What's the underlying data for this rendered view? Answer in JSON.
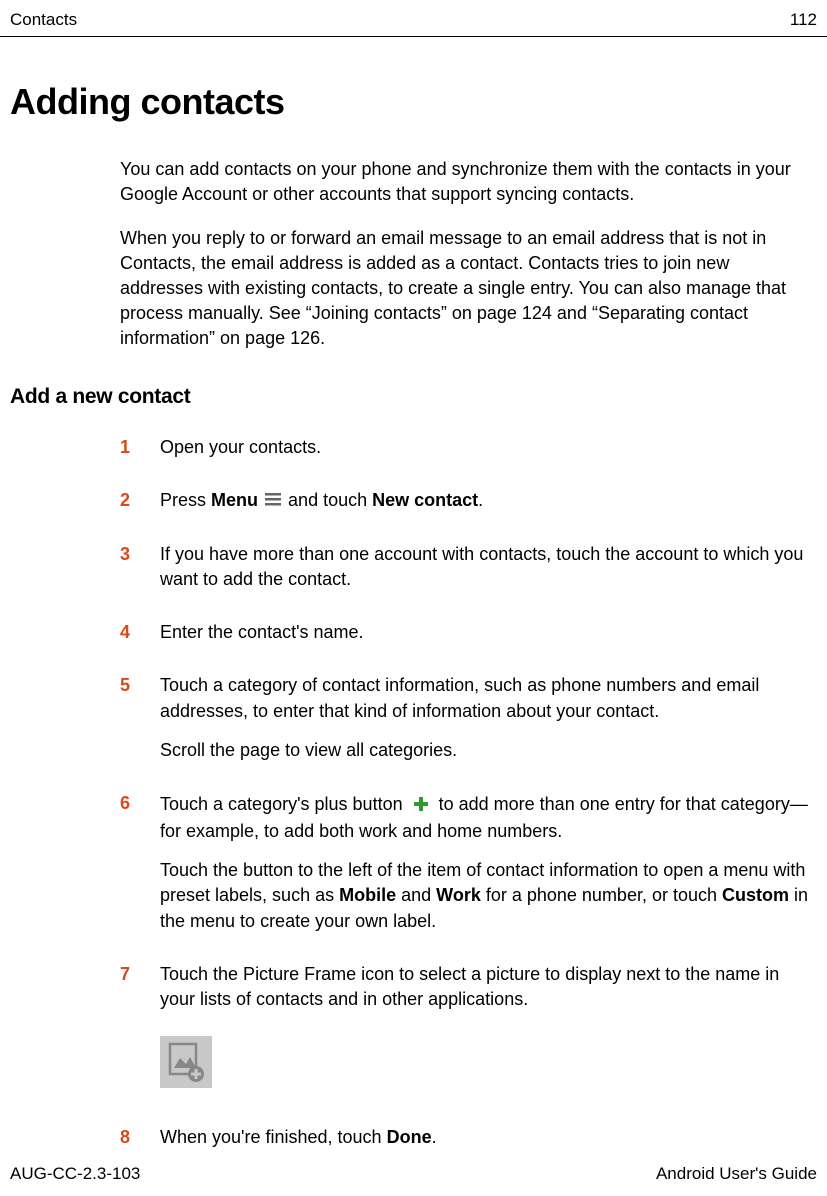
{
  "header": {
    "section": "Contacts",
    "page_number": "112"
  },
  "title": "Adding contacts",
  "intro": {
    "p1": "You can add contacts on your phone and synchronize them with the contacts in your Google Account or other accounts that support syncing contacts.",
    "p2": "When you reply to or forward an email message to an email address that is not in Contacts, the email address is added as a contact. Contacts tries to join new addresses with existing contacts, to create a single entry. You can also manage that process manually. See “Joining contacts” on page 124 and “Separating contact information” on page 126."
  },
  "subtitle": "Add a new contact",
  "steps": {
    "s1": {
      "num": "1",
      "text": "Open your contacts."
    },
    "s2": {
      "num": "2",
      "press": "Press ",
      "menu": "Menu",
      "and_touch": " and touch ",
      "new_contact": "New contact",
      "period": "."
    },
    "s3": {
      "num": "3",
      "text": "If you have more than one account with contacts, touch the account to which you want to add the contact."
    },
    "s4": {
      "num": "4",
      "text": "Enter the contact's name."
    },
    "s5": {
      "num": "5",
      "text": "Touch a category of contact information, such as phone numbers and email addresses, to enter that kind of information about your contact.",
      "sub": "Scroll the page to view all categories."
    },
    "s6": {
      "num": "6",
      "lead": "Touch a category's plus button ",
      "tail": " to add more than one entry for that category—for example, to add both work and home numbers.",
      "sub_pre": "Touch the button to the left of the item of contact information to open a menu with preset labels, such as ",
      "mobile": "Mobile",
      "and": " and ",
      "work": "Work",
      "mid": " for a phone number, or touch ",
      "custom": "Custom",
      "end": " in the menu to create your own label."
    },
    "s7": {
      "num": "7",
      "text": "Touch the Picture Frame icon to select a picture to display next to the name in your lists of contacts and in other applications."
    },
    "s8": {
      "num": "8",
      "pre": "When you're finished, touch ",
      "done": "Done",
      "period": "."
    }
  },
  "footer": {
    "doc_id": "AUG-CC-2.3-103",
    "guide": "Android User's Guide"
  }
}
